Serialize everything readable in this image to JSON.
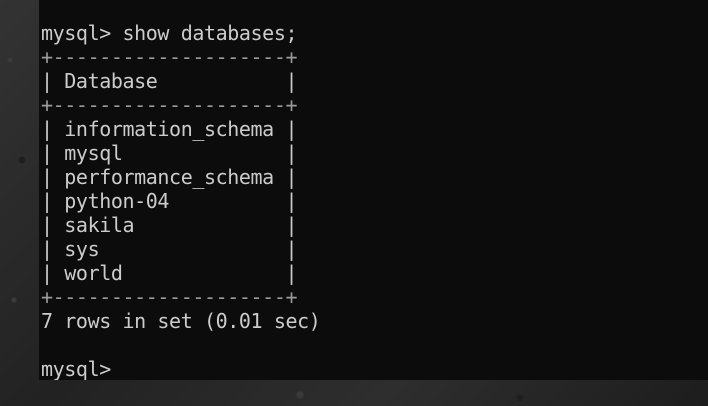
{
  "terminal": {
    "command_line": "mysql> show databases;",
    "border_line": "+--------------------+",
    "header_row": "| Database           |",
    "rows": [
      "| information_schema |",
      "| mysql              |",
      "| performance_schema |",
      "| python-04          |",
      "| sakila             |",
      "| sys                |",
      "| world              |"
    ],
    "result_line": "7 rows in set (0.01 sec)",
    "empty_line": "",
    "prompt_line": "mysql>",
    "colors": {
      "background": "#0c0c0c",
      "text": "#cccccc",
      "desktop": "#2b2b2b"
    }
  }
}
